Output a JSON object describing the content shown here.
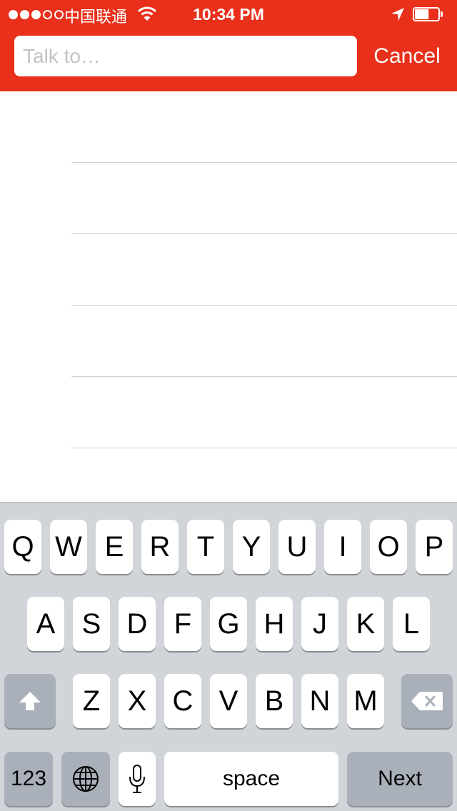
{
  "status_bar": {
    "carrier": "中国联通",
    "time": "10:34 PM",
    "signal_bars_filled": 3,
    "signal_bars_total": 5,
    "battery_level": 0.6
  },
  "header": {
    "background_color": "#e8301b",
    "search_placeholder": "Talk to…",
    "cancel_label": "Cancel"
  },
  "list": {
    "rows": 5
  },
  "keyboard": {
    "row1": [
      "Q",
      "W",
      "E",
      "R",
      "T",
      "Y",
      "U",
      "I",
      "O",
      "P"
    ],
    "row2": [
      "A",
      "S",
      "D",
      "F",
      "G",
      "H",
      "J",
      "K",
      "L"
    ],
    "row3": [
      "Z",
      "X",
      "C",
      "V",
      "B",
      "N",
      "M"
    ],
    "numbers_label": "123",
    "space_label": "space",
    "next_label": "Next"
  }
}
